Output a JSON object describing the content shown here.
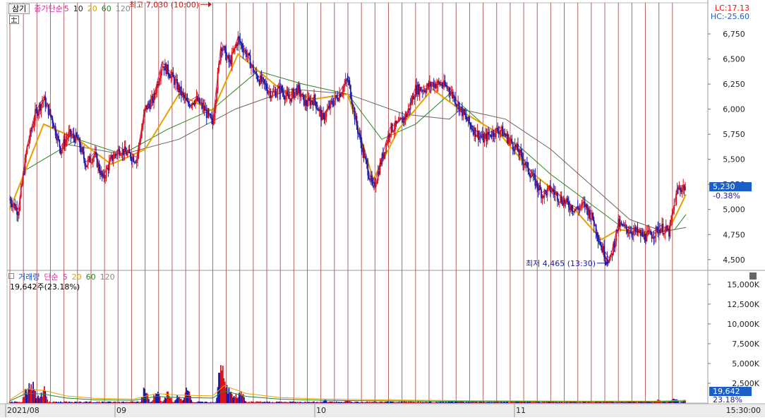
{
  "header": {
    "mode_button": "삼기",
    "series_labels": [
      {
        "text": "종가단순",
        "color": "#cc3399"
      },
      {
        "text": "5",
        "color": "#cc3399"
      },
      {
        "text": "10",
        "color": "#222222"
      },
      {
        "text": "20",
        "color": "#d9a000"
      },
      {
        "text": "60",
        "color": "#228822"
      },
      {
        "text": "120",
        "color": "#888888"
      }
    ],
    "lc": "LC:17.13",
    "hc": "HC:-25.60"
  },
  "volume_header": {
    "labels": [
      {
        "text": "거래량",
        "color": "#1a4fbf"
      },
      {
        "text": "단순",
        "color": "#cc3399"
      },
      {
        "text": "5",
        "color": "#cc3399"
      },
      {
        "text": "20",
        "color": "#d9a000"
      },
      {
        "text": "60",
        "color": "#228822"
      },
      {
        "text": "120",
        "color": "#888888"
      }
    ],
    "value": "19,642주(23.18%)"
  },
  "colors": {
    "up": "#d8141c",
    "down": "#1a1aa8",
    "ma5": "#cc3399",
    "ma20": "#e8a000",
    "ma60": "#228822",
    "ma120": "#666666",
    "grid_v": "#a84848",
    "badge_bg": "#1a5fc8"
  },
  "chart_data": {
    "type": "line",
    "title": "",
    "price_axis": {
      "ticks": [
        "6,750",
        "6,500",
        "6,250",
        "6,000",
        "5,750",
        "5,500",
        "5,250",
        "5,000",
        "4,750",
        "4,500"
      ],
      "ylim": [
        4400,
        7060
      ]
    },
    "volume_axis": {
      "ticks": [
        "15,000K",
        "12,500K",
        "10,000K",
        "7,500K",
        "5,000K",
        "2,500K"
      ],
      "ylim": [
        0,
        16500
      ]
    },
    "x_labels": [
      "2021/08",
      "09",
      "10",
      "11",
      "15:30:00"
    ],
    "annotations": {
      "high": {
        "text": "최고 7,030 (10:00)",
        "value": 7030
      },
      "low": {
        "text": "최저 4,465 (13:30)",
        "value": 4465
      }
    },
    "current": {
      "price": "5,230",
      "change": "-0.38%",
      "value": 5230
    },
    "volume_current": {
      "value": "19,642",
      "pct": "23.18%"
    },
    "series": [
      {
        "name": "종가단순 5",
        "color": "#cc3399"
      },
      {
        "name": "20",
        "color": "#e8a000"
      },
      {
        "name": "60",
        "color": "#228822"
      },
      {
        "name": "120",
        "color": "#666666"
      }
    ],
    "price_path": [
      [
        0,
        5100
      ],
      [
        1.5,
        4980
      ],
      [
        3,
        5600
      ],
      [
        4.5,
        5950
      ],
      [
        6,
        6100
      ],
      [
        7.5,
        5900
      ],
      [
        9,
        5600
      ],
      [
        10.5,
        5750
      ],
      [
        12,
        5700
      ],
      [
        13.5,
        5450
      ],
      [
        15,
        5550
      ],
      [
        16.5,
        5300
      ],
      [
        18,
        5500
      ],
      [
        19.5,
        5600
      ],
      [
        21,
        5550
      ],
      [
        22.5,
        5500
      ],
      [
        24,
        6000
      ],
      [
        25.5,
        6100
      ],
      [
        27,
        6450
      ],
      [
        28.5,
        6350
      ],
      [
        30,
        6200
      ],
      [
        31.5,
        6050
      ],
      [
        33,
        6100
      ],
      [
        34.5,
        6000
      ],
      [
        36,
        5850
      ],
      [
        37.5,
        6650
      ],
      [
        39,
        6450
      ],
      [
        40.5,
        6700
      ],
      [
        42,
        6550
      ],
      [
        43.5,
        6350
      ],
      [
        45,
        6250
      ],
      [
        46.5,
        6150
      ],
      [
        48,
        6200
      ],
      [
        49.5,
        6100
      ],
      [
        51,
        6200
      ],
      [
        52.5,
        6050
      ],
      [
        54,
        6100
      ],
      [
        55.5,
        5900
      ],
      [
        57,
        6050
      ],
      [
        58.5,
        6150
      ],
      [
        60,
        6300
      ],
      [
        61.5,
        5850
      ],
      [
        63,
        5500
      ],
      [
        64.5,
        5200
      ],
      [
        66,
        5500
      ],
      [
        67.5,
        5800
      ],
      [
        69,
        5850
      ],
      [
        70.5,
        5950
      ],
      [
        72,
        6200
      ],
      [
        73.5,
        6200
      ],
      [
        75,
        6250
      ],
      [
        76.5,
        6250
      ],
      [
        78,
        6200
      ],
      [
        79.5,
        6050
      ],
      [
        81,
        5900
      ],
      [
        82.5,
        5780
      ],
      [
        84,
        5700
      ],
      [
        85.5,
        5760
      ],
      [
        87,
        5800
      ],
      [
        88.5,
        5700
      ],
      [
        90,
        5600
      ],
      [
        91.5,
        5450
      ],
      [
        93,
        5300
      ],
      [
        94.5,
        5150
      ],
      [
        96,
        5200
      ],
      [
        97.5,
        5120
      ],
      [
        99,
        5050
      ],
      [
        100.5,
        5000
      ],
      [
        102,
        5050
      ],
      [
        103.5,
        4900
      ],
      [
        105,
        4620
      ],
      [
        106.5,
        4480
      ],
      [
        108,
        4850
      ],
      [
        109.5,
        4800
      ],
      [
        111,
        4780
      ],
      [
        112.5,
        4730
      ],
      [
        114,
        4750
      ],
      [
        115.5,
        4820
      ],
      [
        117,
        4770
      ],
      [
        118.5,
        5200
      ],
      [
        120,
        5230
      ]
    ],
    "ma20_path": [
      [
        0,
        5000
      ],
      [
        6,
        5850
      ],
      [
        12,
        5700
      ],
      [
        18,
        5450
      ],
      [
        24,
        5600
      ],
      [
        30,
        6150
      ],
      [
        36,
        5980
      ],
      [
        40.5,
        6550
      ],
      [
        48,
        6200
      ],
      [
        54,
        6100
      ],
      [
        60,
        6150
      ],
      [
        64.5,
        5300
      ],
      [
        69,
        5800
      ],
      [
        75,
        6200
      ],
      [
        81,
        5950
      ],
      [
        87,
        5750
      ],
      [
        93,
        5350
      ],
      [
        99,
        5080
      ],
      [
        105,
        4700
      ],
      [
        108,
        4800
      ],
      [
        114,
        4760
      ],
      [
        117,
        4800
      ],
      [
        120,
        5150
      ]
    ],
    "ma60_path": [
      [
        3,
        5400
      ],
      [
        12,
        5700
      ],
      [
        20,
        5550
      ],
      [
        28,
        5800
      ],
      [
        36,
        6000
      ],
      [
        44,
        6380
      ],
      [
        52,
        6250
      ],
      [
        60,
        6150
      ],
      [
        66,
        5700
      ],
      [
        72,
        5850
      ],
      [
        78,
        6150
      ],
      [
        84,
        5850
      ],
      [
        90,
        5650
      ],
      [
        96,
        5350
      ],
      [
        102,
        5100
      ],
      [
        108,
        4850
      ],
      [
        114,
        4760
      ],
      [
        118,
        4800
      ],
      [
        120,
        4950
      ]
    ],
    "ma120_path": [
      [
        10,
        5650
      ],
      [
        20,
        5550
      ],
      [
        30,
        5700
      ],
      [
        40,
        6000
      ],
      [
        50,
        6200
      ],
      [
        60,
        6150
      ],
      [
        70,
        5950
      ],
      [
        78,
        5900
      ],
      [
        80,
        6000
      ],
      [
        88,
        5900
      ],
      [
        96,
        5600
      ],
      [
        104,
        5200
      ],
      [
        110,
        4900
      ],
      [
        116,
        4780
      ],
      [
        120,
        4820
      ]
    ],
    "volume_spikes": [
      [
        3,
        2800
      ],
      [
        3.5,
        4200
      ],
      [
        4,
        3500
      ],
      [
        5,
        1500
      ],
      [
        6,
        2500
      ],
      [
        24,
        2700
      ],
      [
        26,
        3000
      ],
      [
        28,
        2200
      ],
      [
        30,
        1800
      ],
      [
        31.5,
        2600
      ],
      [
        37.5,
        9200
      ],
      [
        38,
        6500
      ],
      [
        39,
        3200
      ],
      [
        40,
        1800
      ],
      [
        41,
        2200
      ],
      [
        56,
        500
      ],
      [
        60,
        600
      ],
      [
        70,
        400
      ],
      [
        80,
        300
      ],
      [
        90,
        300
      ],
      [
        100,
        250
      ],
      [
        110,
        300
      ],
      [
        115,
        600
      ],
      [
        118,
        900
      ],
      [
        120,
        700
      ]
    ],
    "volume_ma": [
      [
        0,
        400
      ],
      [
        3,
        1800
      ],
      [
        6,
        1600
      ],
      [
        10,
        900
      ],
      [
        15,
        600
      ],
      [
        22,
        500
      ],
      [
        26,
        1200
      ],
      [
        30,
        1000
      ],
      [
        36,
        900
      ],
      [
        38,
        2200
      ],
      [
        42,
        1200
      ],
      [
        48,
        700
      ],
      [
        56,
        500
      ],
      [
        66,
        400
      ],
      [
        80,
        300
      ],
      [
        100,
        250
      ],
      [
        115,
        250
      ],
      [
        120,
        350
      ]
    ]
  }
}
